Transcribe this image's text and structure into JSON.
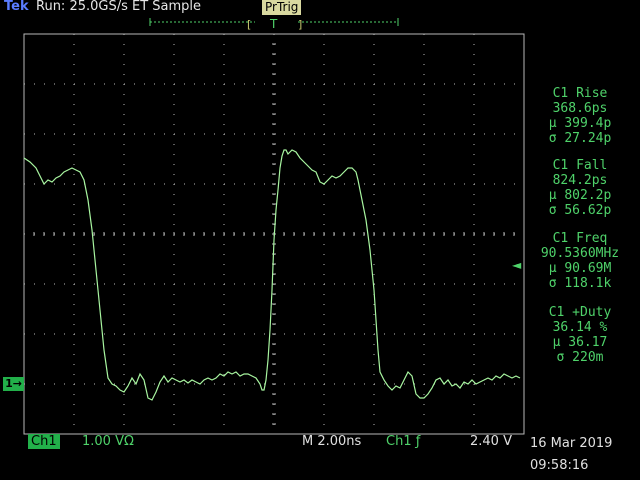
{
  "header": {
    "brand": "Tek",
    "status": "Run: 25.0GS/s ET Sample",
    "trigger_mode": "PrTrig",
    "trigger_marker": "T"
  },
  "measurements": [
    {
      "title": "C1 Rise",
      "value": "368.6ps",
      "mean": "µ 399.4p",
      "sigma": "σ 27.24p"
    },
    {
      "title": "C1 Fall",
      "value": "824.2ps",
      "mean": "µ 802.2p",
      "sigma": "σ 56.62p"
    },
    {
      "title": "C1 Freq",
      "value": "90.5360MHz",
      "mean": "µ 90.69M",
      "sigma": "σ 118.1k"
    },
    {
      "title": "C1 +Duty",
      "value": "36.14 %",
      "mean": "µ 36.17",
      "sigma": "σ 220m"
    }
  ],
  "markers": {
    "ch1": "1→",
    "trigger_level": "◄"
  },
  "footer": {
    "channel": "Ch1",
    "scale": "1.00 VΩ",
    "timebase": "M 2.00ns",
    "trigger_source": "Ch1 ƒ",
    "trigger_level": "2.40 V",
    "date": "16 Mar 2019",
    "time": "09:58:16"
  },
  "colors": {
    "trace": "#a8f5a0",
    "grid": "#b8b8b8",
    "accent": "#4fd26a"
  }
}
